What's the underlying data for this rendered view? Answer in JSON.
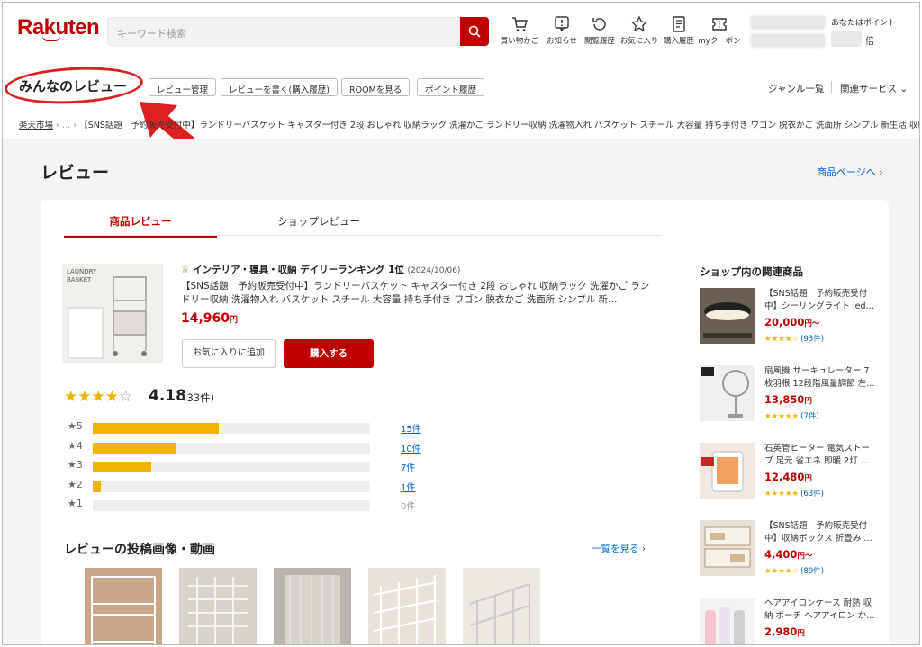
{
  "header": {
    "logo": "Rakuten",
    "search_placeholder": "キーワード検索",
    "icons": [
      {
        "name": "cart-icon",
        "label": "買い物かご"
      },
      {
        "name": "notice-icon",
        "label": "お知らせ"
      },
      {
        "name": "history-icon",
        "label": "閲覧履歴"
      },
      {
        "name": "star-icon",
        "label": "お気に入り"
      },
      {
        "name": "receipt-icon",
        "label": "購入履歴"
      },
      {
        "name": "coupon-icon",
        "label": "myクーポン"
      }
    ],
    "points_label": "あなたはポイント",
    "points_suffix": "倍"
  },
  "subnav": {
    "title": "みんなのレビュー",
    "pills": [
      "レビュー管理",
      "レビューを書く(購入履歴)",
      "ROOMを見る",
      "ポイント履歴"
    ],
    "genre": "ジャンル一覧",
    "related": "関連サービス"
  },
  "breadcrumb": {
    "root": "楽天市場",
    "ellipsis": "…",
    "text": "【SNS話題　予約販売受付中】ランドリーバスケット キャスター付き 2段 おしゃれ 収納ラック 洗濯かご ランドリー収納 洗濯物入れ バスケット スチール 大容量 持ち手付き ワゴン 脱衣かご 洗面所 シンプル 新生活 収納"
  },
  "page": {
    "title": "レビュー",
    "shop_link": "商品ページへ"
  },
  "tabs": [
    "商品レビュー",
    "ショップレビュー"
  ],
  "product": {
    "image_text": "LAUNDRY BASKET",
    "rank": "インテリア・寝具・収納 デイリーランキング 1位",
    "rank_date": "(2024/10/06)",
    "name": "【SNS話題　予約販売受付中】ランドリーバスケット キャスター付き 2段 おしゃれ 収納ラック 洗濯かご ランドリー収納 洗濯物入れ バスケット スチール 大容量 持ち手付き ワゴン 脱衣かご 洗面所 シンプル 新…",
    "price": "14,960",
    "price_unit": "円",
    "fav_button": "お気に入りに追加",
    "buy_button": "購入する"
  },
  "rating": {
    "average": "4.18",
    "count": "(33件)",
    "stars": 4.18,
    "breakdown": [
      {
        "star": "5",
        "count": 15,
        "label": "15件"
      },
      {
        "star": "4",
        "count": 10,
        "label": "10件"
      },
      {
        "star": "3",
        "count": 7,
        "label": "7件"
      },
      {
        "star": "2",
        "count": 1,
        "label": "1件"
      },
      {
        "star": "1",
        "count": 0,
        "label": "0件"
      }
    ]
  },
  "media": {
    "title": "レビューの投稿画像・動画",
    "more": "一覧を見る"
  },
  "sidebar": {
    "title": "ショップ内の関連商品",
    "items": [
      {
        "name": "【SNS話題　予約販売受付中】シーリングライト led…",
        "price": "20,000",
        "unit": "円〜",
        "stars": "★★★★☆",
        "count": "(93件)"
      },
      {
        "name": "扇風機 サーキュレーター 7枚羽根 12段階風量調節 左…",
        "price": "13,850",
        "unit": "円",
        "stars": "★★★★★",
        "count": "(7件)"
      },
      {
        "name": "石英管ヒーター 電気ストーブ 足元 省エネ 即暖 2灯 …",
        "price": "12,480",
        "unit": "円",
        "stars": "★★★★★",
        "count": "(63件)"
      },
      {
        "name": "【SNS話題　予約販売受付中】収納ボックス 折畳み …",
        "price": "4,400",
        "unit": "円〜",
        "stars": "★★★★☆",
        "count": "(89件)"
      },
      {
        "name": "ヘアアイロンケース 耐熱 収納 ポーチ ヘアアイロン か…",
        "price": "2,980",
        "unit": "円",
        "stars": "",
        "count": ""
      }
    ]
  },
  "colors": {
    "brand": "#bf0000",
    "star": "#f0b400",
    "link": "#0066cc",
    "annotation": "#e02020"
  }
}
